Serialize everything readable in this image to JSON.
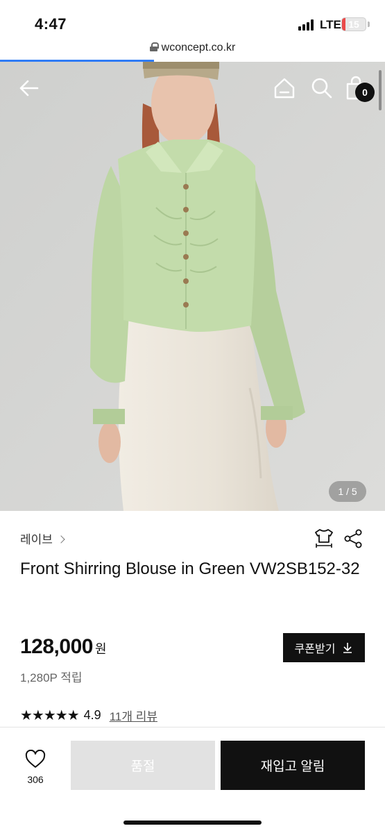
{
  "status_bar": {
    "time": "4:47",
    "network": "LTE",
    "battery": "15",
    "battery_level": 0.15
  },
  "browser": {
    "url": "wconcept.co.kr",
    "load_progress": 0.4
  },
  "hero": {
    "nav_icons": [
      "back-arrow-icon",
      "home-icon",
      "search-icon",
      "shopping-bag-icon"
    ],
    "cart_count": "0",
    "image_counter": "1 / 5"
  },
  "product": {
    "brand": "레이브",
    "title": "Front Shirring Blouse in Green VW2SB152-32",
    "price": "128,000",
    "price_unit": "원",
    "points": "1,280P 적립",
    "stars": "★★★★★",
    "rating": "4.9",
    "review_link": "11개 리뷰",
    "coupon_button": "쿠폰받기",
    "action_icons": [
      "size-guide-icon",
      "share-icon"
    ]
  },
  "bottom_bar": {
    "wish_count": "306",
    "soldout_label": "품절",
    "restock_label": "재입고 알림"
  },
  "colors": {
    "accent": "#111111",
    "progress": "#2f7cf6",
    "battery_low": "#ea4b4b",
    "blouse": "#c3dcab",
    "skirt": "#ece7dc",
    "soldout_bg": "#e2e2e2"
  }
}
